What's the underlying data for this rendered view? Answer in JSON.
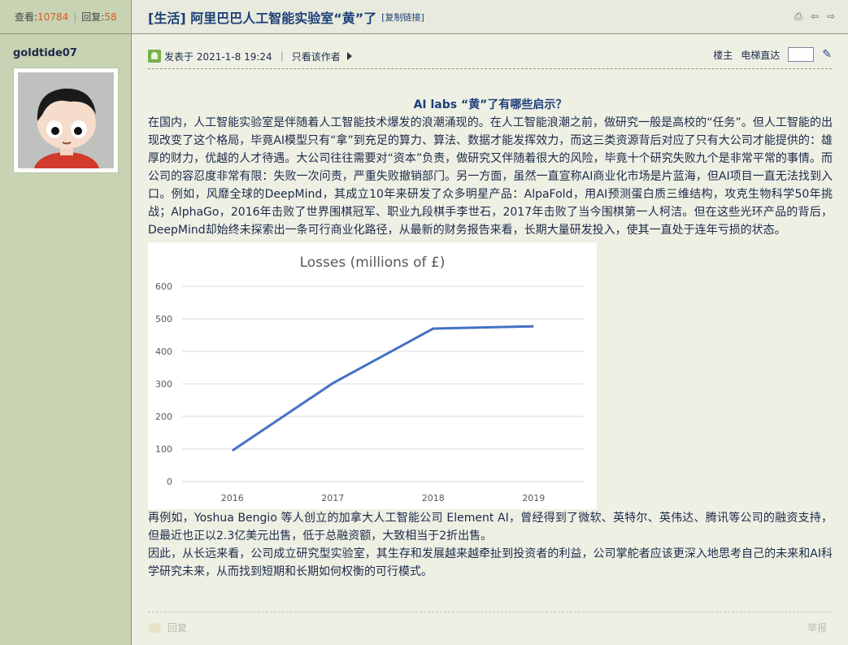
{
  "stats": {
    "views_label": "查看:",
    "views": "10784",
    "replies_label": "回复:",
    "replies": "58"
  },
  "author": {
    "name": "goldtide07"
  },
  "thread": {
    "title": "[生活] 阿里巴巴人工智能实验室“黄”了",
    "copy_link": "[复制链接]",
    "icons": [
      "print-icon",
      "prev-thread-icon",
      "next-thread-icon"
    ]
  },
  "post_meta": {
    "posted_label": "发表于 2021-1-8 19:24",
    "author_only": "只看该作者",
    "floor": "楼主",
    "jump_label": "电梯直达"
  },
  "article": {
    "heading": "AI labs “黄”了有哪些启示？",
    "paragraph1": "在国内，人工智能实验室是伴随着人工智能技术爆发的浪潮涌现的。在人工智能浪潮之前，做研究一般是高校的“任务”。但人工智能的出现改变了这个格局，毕竟AI模型只有“拿”到充足的算力、算法、数据才能发挥效力，而这三类资源背后对应了只有大公司才能提供的：雄厚的财力，优越的人才待遇。大公司往往需要对“资本”负责，做研究又伴随着很大的风险，毕竟十个研究失败九个是非常平常的事情。而公司的容忍度非常有限：失败一次问责，严重失败撤销部门。另一方面，虽然一直宣称AI商业化市场是片蓝海，但AI项目一直无法找到入口。例如，风靡全球的DeepMind，其成立10年来研发了众多明星产品：AlpaFold，用AI预测蛋白质三维结构，攻克生物科学50年挑战；AlphaGo，2016年击败了世界围棋冠军、职业九段棋手李世石，2017年击败了当今围棋第一人柯洁。但在这些光环产品的背后，DeepMind却始终未探索出一条可行商业化路径，从最新的财务报告来看，长期大量研发投入，使其一直处于连年亏损的状态。",
    "paragraph2": "再例如，Yoshua Bengio 等人创立的加拿大人工智能公司 Element AI，曾经得到了微软、英特尔、英伟达、腾讯等公司的融资支持，但最近也正以2.3亿美元出售，低于总融资额，大致相当于2折出售。",
    "paragraph3": "因此，从长远来看，公司成立研究型实验室，其生存和发展越来越牵扯到投资者的利益，公司掌舵者应该更深入地思考自己的未来和AI科学研究未来，从而找到短期和长期如何权衡的可行模式。"
  },
  "chart_data": {
    "type": "line",
    "title": "Losses (millions of £)",
    "categories": [
      "2016",
      "2017",
      "2018",
      "2019"
    ],
    "values": [
      95,
      302,
      470,
      477
    ],
    "y_ticks": [
      "0",
      "100",
      "200",
      "300",
      "400",
      "500",
      "600"
    ],
    "ylim": [
      0,
      600
    ],
    "grid": true,
    "color": "#4472c4"
  },
  "footer": {
    "reply": "回复",
    "report": "举报"
  }
}
